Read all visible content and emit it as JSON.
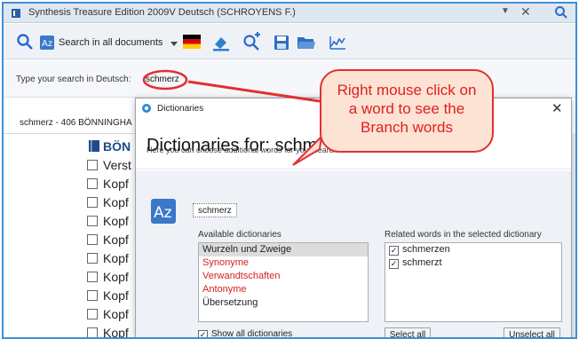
{
  "window": {
    "title": "Synthesis Treasure Edition 2009V Deutsch (SCHROYENS F.)",
    "dropdown_glyph": "▼",
    "close_glyph": "✕"
  },
  "toolbar": {
    "search_in_all_label": "Search in all documents"
  },
  "search": {
    "label": "Type your search in Deutsch:",
    "value": "schmerz"
  },
  "results": {
    "header": "schmerz - 406 BÖNNINGHA",
    "book_title": "BÖN",
    "rows": [
      "Verst",
      "Kopf",
      "Kopf",
      "Kopf",
      "Kopf",
      "Kopf",
      "Kopf",
      "Kopf",
      "Kopf",
      "Kopf"
    ]
  },
  "dialog": {
    "title": "Dictionaries",
    "heading": "Dictionaries for: schm",
    "subtitle": "Here you can choose additional words for your search",
    "word": "schmerz",
    "available_label": "Available dictionaries",
    "related_label": "Related words in the selected dictionary",
    "dictionaries": [
      {
        "label": "Wurzeln und Zweige",
        "selected": true,
        "color": "#222222"
      },
      {
        "label": "Synonyme",
        "selected": false,
        "color": "#d62020"
      },
      {
        "label": "Verwandtschaften",
        "selected": false,
        "color": "#d62020"
      },
      {
        "label": "Antonyme",
        "selected": false,
        "color": "#d62020"
      },
      {
        "label": "Übersetzung",
        "selected": false,
        "color": "#222222"
      }
    ],
    "related_words": [
      {
        "label": "schmerzen",
        "checked": true
      },
      {
        "label": "schmerzt",
        "checked": true
      }
    ],
    "show_all_label": "Show all dictionaries",
    "show_all_checked": true,
    "select_all_label": "Select all",
    "unselect_all_label": "Unselect all"
  },
  "callout": {
    "text_line1": "Right mouse click on",
    "text_line2": "a word to see the",
    "text_line3": "Branch words",
    "border_color": "#e03030",
    "fill_color": "#fde3d4"
  },
  "colors": {
    "frame_border": "#3f8fd6",
    "accent_red": "#d62020",
    "book_blue": "#1e4a8a"
  }
}
